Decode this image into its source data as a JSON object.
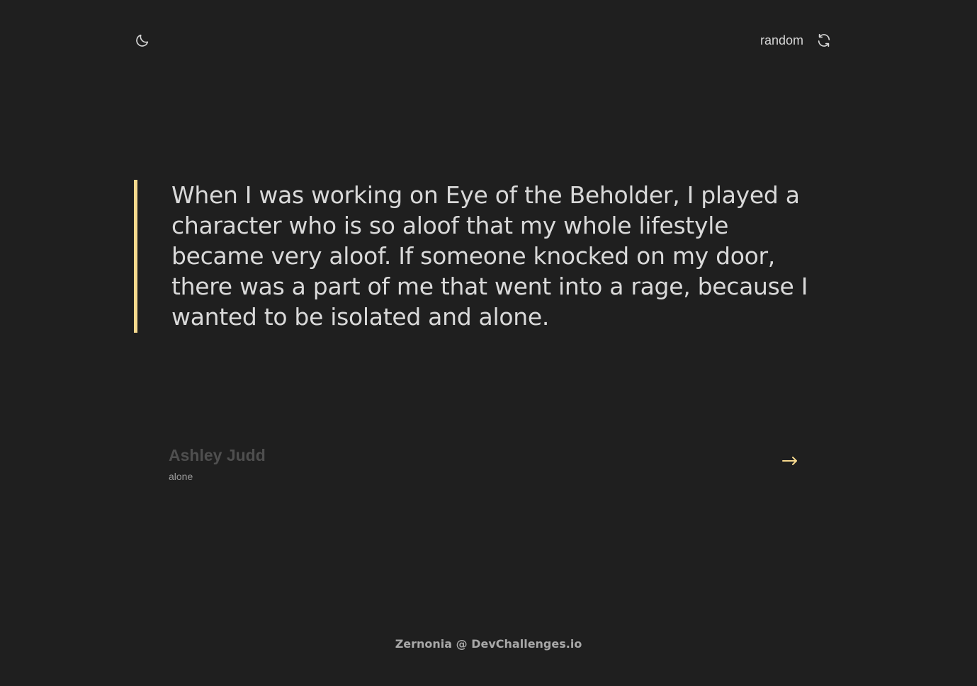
{
  "header": {
    "theme_icon": "moon-icon",
    "random_label": "random",
    "random_icon": "refresh-icon"
  },
  "quote": {
    "text": "When I was working on Eye of the Beholder, I played a character who is so aloof that my whole lifestyle became very aloof. If someone knocked on my door, there was a part of me that went into a rage, because I wanted to be isolated and alone.",
    "accent_color": "#f6d98e"
  },
  "author": {
    "name": "Ashley Judd",
    "genre": "alone",
    "arrow_icon": "arrow-right-icon"
  },
  "footer": {
    "credit": "Zernonia @ DevChallenges.io"
  },
  "colors": {
    "background": "#1f1f1f",
    "accent": "#f6d98e",
    "text": "#d9d9d9"
  }
}
